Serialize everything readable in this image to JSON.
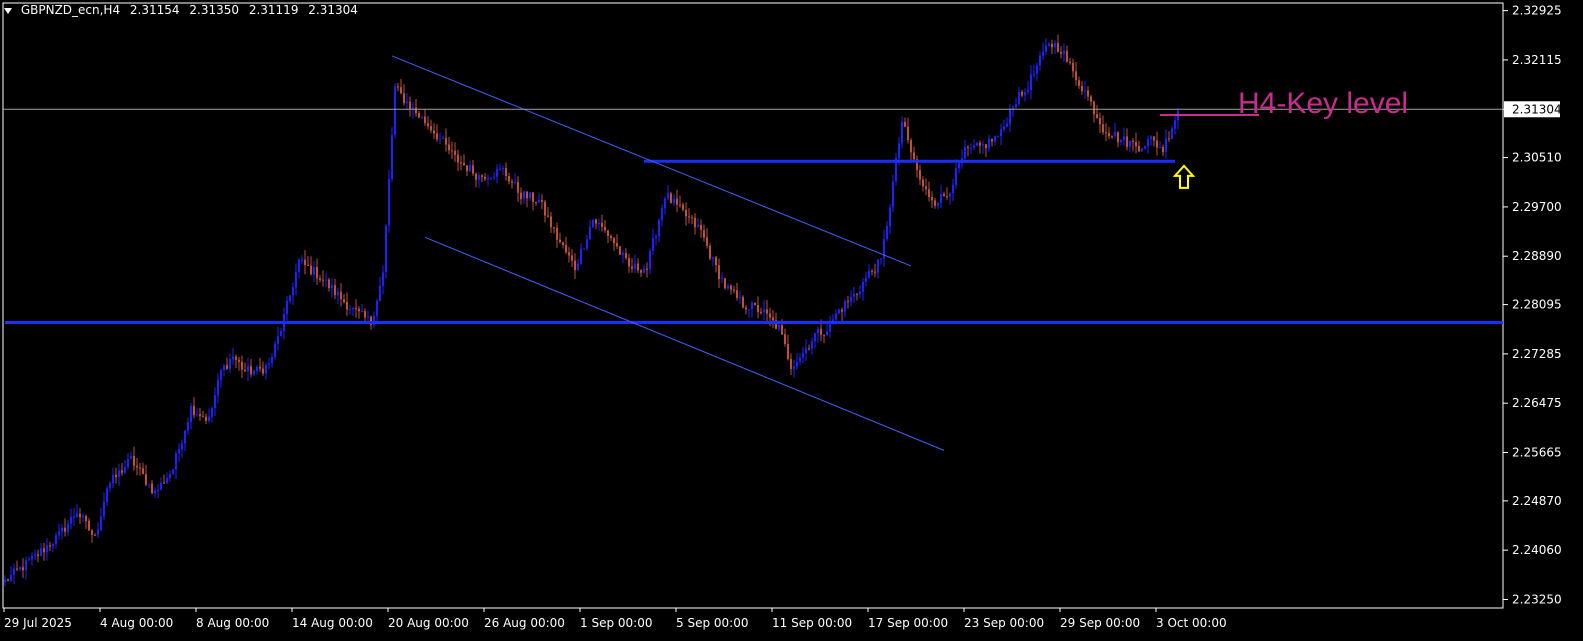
{
  "header": {
    "symbol": "GBPNZD_ecn,H4",
    "open": "2.31154",
    "high": "2.31350",
    "low": "2.31119",
    "close": "2.31304"
  },
  "colors": {
    "background": "#000000",
    "axis": "#ffffff",
    "bull": "#2020ff",
    "bear": "#c0503a",
    "line": "#1a2fff",
    "channel": "#3f5fff",
    "key_level": "#c82c8c",
    "arrow": "#ffff00"
  },
  "chart_data": {
    "type": "candlestick",
    "symbol": "GBPNZD_ecn",
    "timeframe": "H4",
    "y_ticks": [
      "2.32925",
      "2.32115",
      "2.31304",
      "2.30510",
      "2.29700",
      "2.28890",
      "2.28095",
      "2.27285",
      "2.26475",
      "2.25665",
      "2.24870",
      "2.24060",
      "2.23250"
    ],
    "ylim": [
      2.2311,
      2.3305
    ],
    "current_price": "2.31304",
    "x_ticks": [
      "29 Jul 2025",
      "4 Aug 00:00",
      "8 Aug 00:00",
      "14 Aug 00:00",
      "20 Aug 00:00",
      "26 Aug 00:00",
      "1 Sep 00:00",
      "5 Sep 00:00",
      "11 Sep 00:00",
      "17 Sep 00:00",
      "23 Sep 00:00",
      "29 Sep 00:00",
      "3 Oct 00:00"
    ],
    "close_path": [
      [
        0,
        2.2355
      ],
      [
        10,
        2.2395
      ],
      [
        18,
        2.243
      ],
      [
        24,
        2.247
      ],
      [
        30,
        2.2425
      ],
      [
        34,
        2.251
      ],
      [
        42,
        2.2555
      ],
      [
        50,
        2.25
      ],
      [
        56,
        2.254
      ],
      [
        62,
        2.264
      ],
      [
        68,
        2.262
      ],
      [
        72,
        2.27
      ],
      [
        76,
        2.2725
      ],
      [
        80,
        2.27
      ],
      [
        84,
        2.27
      ],
      [
        88,
        2.271
      ],
      [
        92,
        2.277
      ],
      [
        98,
        2.288
      ],
      [
        104,
        2.286
      ],
      [
        110,
        2.283
      ],
      [
        116,
        2.28
      ],
      [
        122,
        2.278
      ],
      [
        126,
        2.286
      ],
      [
        130,
        2.3165
      ],
      [
        136,
        2.313
      ],
      [
        142,
        2.31
      ],
      [
        150,
        2.305
      ],
      [
        158,
        2.302
      ],
      [
        166,
        2.303
      ],
      [
        172,
        2.299
      ],
      [
        178,
        2.298
      ],
      [
        184,
        2.292
      ],
      [
        190,
        2.287
      ],
      [
        196,
        2.295
      ],
      [
        202,
        2.292
      ],
      [
        208,
        2.287
      ],
      [
        214,
        2.287
      ],
      [
        220,
        2.299
      ],
      [
        226,
        2.296
      ],
      [
        232,
        2.293
      ],
      [
        236,
        2.288
      ],
      [
        240,
        2.284
      ],
      [
        246,
        2.281
      ],
      [
        252,
        2.28
      ],
      [
        258,
        2.277
      ],
      [
        262,
        2.271
      ],
      [
        266,
        2.273
      ],
      [
        270,
        2.276
      ],
      [
        274,
        2.277
      ],
      [
        278,
        2.28
      ],
      [
        284,
        2.283
      ],
      [
        288,
        2.286
      ],
      [
        292,
        2.288
      ],
      [
        295,
        2.2975
      ],
      [
        299,
        2.311
      ],
      [
        302,
        2.306
      ],
      [
        306,
        2.3
      ],
      [
        310,
        2.298
      ],
      [
        314,
        2.299
      ],
      [
        320,
        2.306
      ],
      [
        326,
        2.307
      ],
      [
        332,
        2.309
      ],
      [
        336,
        2.314
      ],
      [
        340,
        2.316
      ],
      [
        344,
        2.32
      ],
      [
        348,
        2.324
      ],
      [
        352,
        2.323
      ],
      [
        356,
        2.319
      ],
      [
        360,
        2.316
      ],
      [
        366,
        2.31
      ],
      [
        372,
        2.308
      ],
      [
        378,
        2.307
      ],
      [
        382,
        2.308
      ],
      [
        386,
        2.3065
      ],
      [
        391,
        2.3128
      ]
    ],
    "lines": [
      {
        "name": "resistance-level",
        "type": "horizontal",
        "price": 2.3045,
        "from_bar": 213,
        "to_bar": 390
      },
      {
        "name": "support-level",
        "type": "horizontal",
        "price": 2.278,
        "from_bar": 0,
        "to_bar": 520
      },
      {
        "name": "channel-upper",
        "type": "trend",
        "start": [
          129,
          2.3218
        ],
        "end": [
          302,
          2.2873
        ]
      },
      {
        "name": "channel-lower",
        "type": "trend",
        "start": [
          140,
          2.292
        ],
        "end": [
          313,
          2.257
        ]
      }
    ],
    "annotations": {
      "key_level_label": "H4-Key level",
      "key_level_price": 2.3121,
      "arrow_direction": "up"
    },
    "grid": false
  }
}
